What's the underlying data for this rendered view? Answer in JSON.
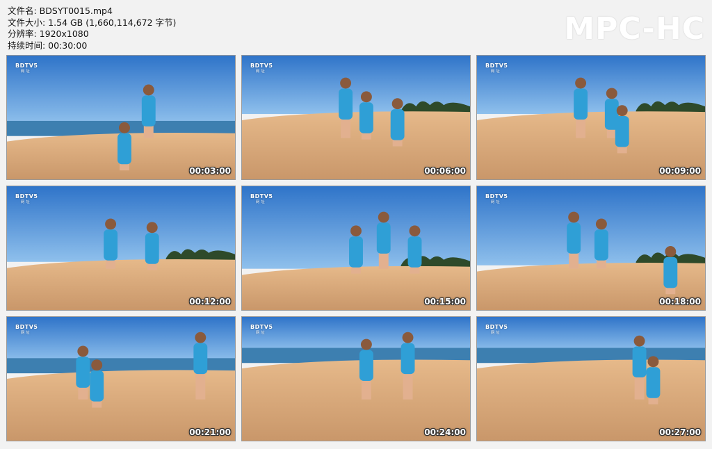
{
  "info": {
    "filename_line": "文件名: BDSYT0015.mp4",
    "size_line": "文件大小: 1.54 GB (1,660,114,672 字节)",
    "resolution_line": "分辨率: 1920x1080",
    "duration_line": "持续时间: 00:30:00"
  },
  "brand": "MPC-HC",
  "watermark": {
    "logo": "BDTV5",
    "sub": "网 址"
  },
  "thumbnails": [
    {
      "timestamp": "00:03:00",
      "scene": "beach-wide"
    },
    {
      "timestamp": "00:06:00",
      "scene": "digging"
    },
    {
      "timestamp": "00:09:00",
      "scene": "digging"
    },
    {
      "timestamp": "00:12:00",
      "scene": "kneeling"
    },
    {
      "timestamp": "00:15:00",
      "scene": "digging"
    },
    {
      "timestamp": "00:18:00",
      "scene": "standing"
    },
    {
      "timestamp": "00:21:00",
      "scene": "sea"
    },
    {
      "timestamp": "00:24:00",
      "scene": "sea"
    },
    {
      "timestamp": "00:27:00",
      "scene": "sea"
    }
  ],
  "colors": {
    "sky_top": "#2f74c9",
    "sky_bottom": "#8fc0ec",
    "sand": "#e6b98a",
    "sand_dark": "#c9976a",
    "sea": "#3d7fb0",
    "trees": "#2e4a2a",
    "dress": "#2f9fd6"
  }
}
